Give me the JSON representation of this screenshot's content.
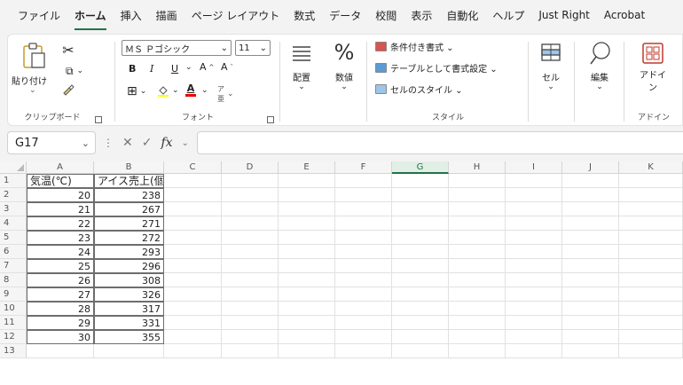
{
  "menu": {
    "tabs": [
      "ファイル",
      "ホーム",
      "挿入",
      "描画",
      "ページ レイアウト",
      "数式",
      "データ",
      "校閲",
      "表示",
      "自動化",
      "ヘルプ",
      "Just Right",
      "Acrobat"
    ],
    "active": "ホーム"
  },
  "ribbon": {
    "clipboard": {
      "paste": "貼り付け",
      "label": "クリップボード"
    },
    "font": {
      "name": "ＭＳ Ｐゴシック",
      "size": "11",
      "bold": "B",
      "italic": "I",
      "underline": "U",
      "grow": "A",
      "shrink": "A",
      "label": "フォント"
    },
    "alignment": {
      "label": "配置"
    },
    "number": {
      "symbol": "%",
      "label": "数値"
    },
    "styles": {
      "conditional": "条件付き書式 ⌄",
      "table": "テーブルとして書式設定 ⌄",
      "cell_styles": "セルのスタイル ⌄",
      "label": "スタイル"
    },
    "cells": {
      "label": "セル"
    },
    "editing": {
      "label": "編集"
    },
    "addins": {
      "button": "アドイン",
      "label": "アドイン"
    }
  },
  "formula_bar": {
    "name_box": "G17",
    "fx": "fx",
    "value": ""
  },
  "sheet": {
    "columns": [
      "A",
      "B",
      "C",
      "D",
      "E",
      "F",
      "G",
      "H",
      "I",
      "J",
      "K"
    ],
    "selected_column": "G",
    "rows": [
      "1",
      "2",
      "3",
      "4",
      "5",
      "6",
      "7",
      "8",
      "9",
      "10",
      "11",
      "12",
      "13"
    ],
    "header": [
      "気温(℃)",
      "アイス売上(個)"
    ],
    "data": [
      [
        "20",
        "238"
      ],
      [
        "21",
        "267"
      ],
      [
        "22",
        "271"
      ],
      [
        "23",
        "272"
      ],
      [
        "24",
        "293"
      ],
      [
        "25",
        "296"
      ],
      [
        "26",
        "308"
      ],
      [
        "27",
        "326"
      ],
      [
        "28",
        "317"
      ],
      [
        "29",
        "331"
      ],
      [
        "30",
        "355"
      ]
    ]
  },
  "colors": {
    "accent": "#217346"
  }
}
